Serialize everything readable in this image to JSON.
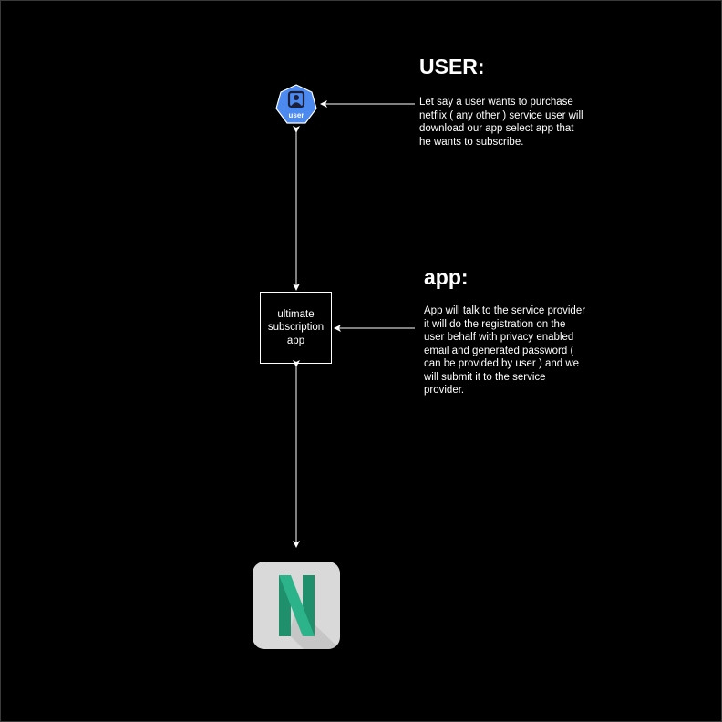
{
  "user_section": {
    "heading": "USER:",
    "description": "Let say a user wants to purchase netflix ( any other ) service user will download our app select app that he wants to subscribe."
  },
  "app_section": {
    "heading": "app:",
    "description": "App will talk to the service provider it will do the registration on the user behalf with privacy enabled email and generated password ( can be provided by user ) and we will submit it to the service provider."
  },
  "nodes": {
    "user_icon_label": "user",
    "app_box_label": "ultimate\nsubscription\napp",
    "service_icon": "netflix-n-icon"
  },
  "colors": {
    "background": "#000000",
    "user_icon": "#4d8af0",
    "netflix_tile": "#d9d9d9",
    "netflix_n": "#2db38a"
  }
}
